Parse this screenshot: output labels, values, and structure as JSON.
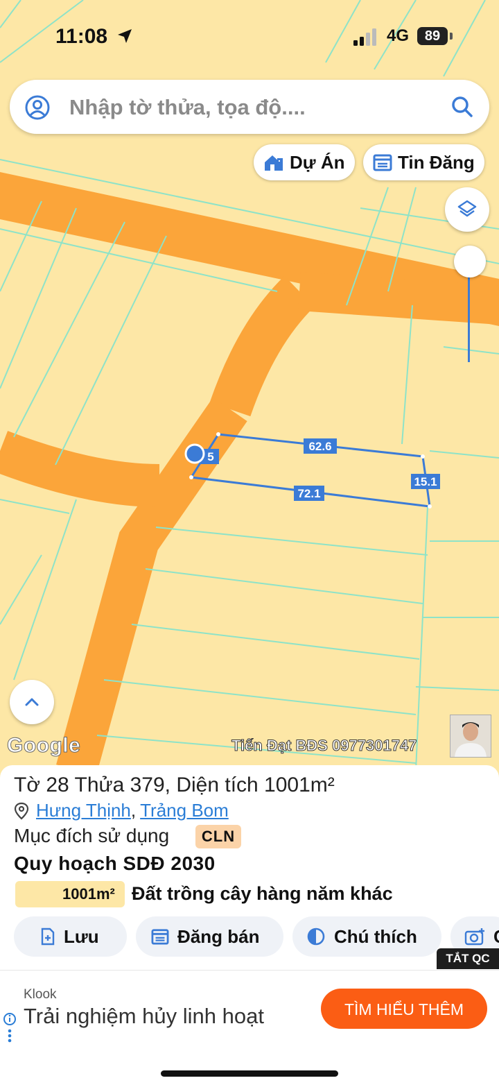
{
  "status_bar": {
    "time": "11:08",
    "network": "4G",
    "battery": "89"
  },
  "search": {
    "placeholder": "Nhập tờ thửa, tọa độ...."
  },
  "chips": {
    "projects": "Dự Án",
    "listings": "Tin Đăng"
  },
  "map": {
    "google_label": "Google",
    "watermark": "Tiến Đạt BĐS 0977301747",
    "dimensions": {
      "top": "62.6",
      "right": "15.1",
      "bottom": "72.1",
      "left": "5"
    },
    "colors": {
      "land": "#fde7a6",
      "road": "#fba53a",
      "parcel_line": "#8ee3c8",
      "selection": "#3b7bd6"
    }
  },
  "parcel": {
    "title": "Tờ 28 Thửa 379, Diện tích 1001m²",
    "ward": "Hưng Thịnh",
    "district": "Trảng Bom",
    "purpose_label": "Mục đích sử dụng",
    "purpose_code": "CLN",
    "plan_title": "Quy hoạch SDĐ 2030",
    "plan_area": "1001m²",
    "plan_type": "Đất trồng cây hàng năm khác"
  },
  "actions": {
    "save": "Lưu",
    "post": "Đăng bán",
    "legend": "Chú thích",
    "photo": "C"
  },
  "ad": {
    "close": "TẮT QC",
    "brand": "Klook",
    "text": "Trải nghiệm hủy linh hoạt",
    "cta": "TÌM HIỂU THÊM"
  }
}
